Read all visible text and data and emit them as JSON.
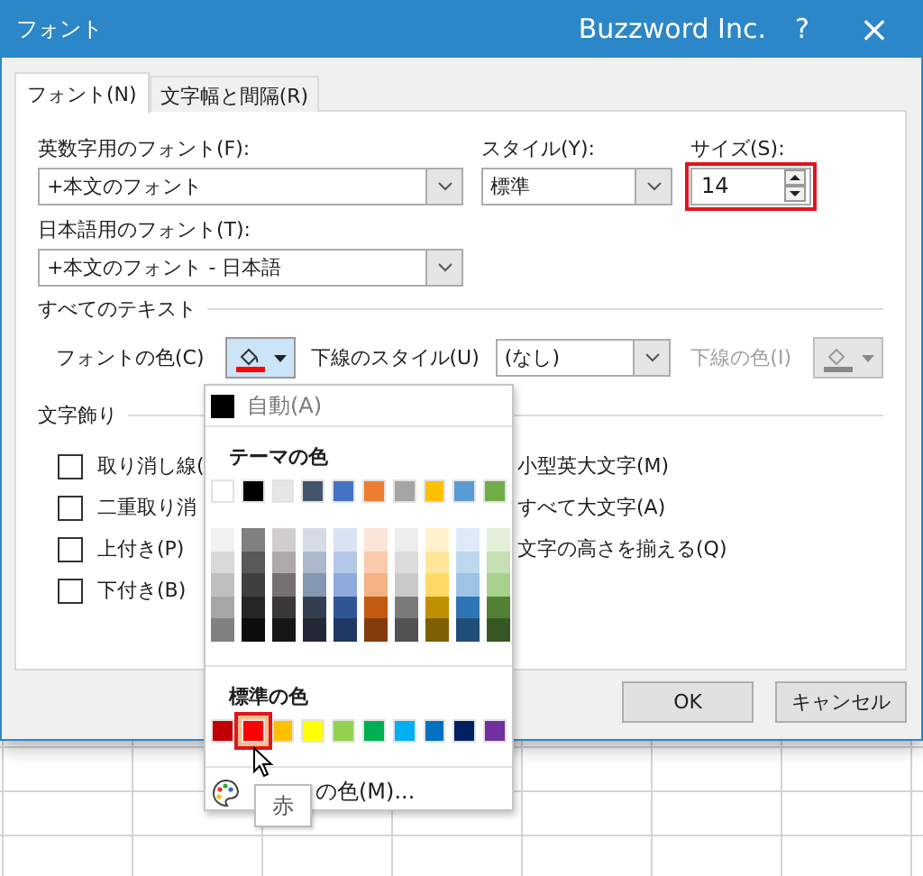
{
  "window": {
    "title": "フォント",
    "brand": "Buzzword Inc.",
    "help": "?",
    "close": "×"
  },
  "tabs": [
    {
      "label": "フォント(N)",
      "selected": true
    },
    {
      "label": "文字幅と間隔(R)",
      "selected": false
    }
  ],
  "fonts": {
    "latin_label": "英数字用のフォント(F):",
    "latin_value": "+本文のフォント",
    "style_label": "スタイル(Y):",
    "style_value": "標準",
    "size_label": "サイズ(S):",
    "size_value": "14",
    "size_highlighted": true,
    "japanese_label": "日本語用のフォント(T):",
    "japanese_value": "+本文のフォント - 日本語"
  },
  "all_text": {
    "heading": "すべてのテキスト",
    "font_color_label": "フォントの色(C)",
    "font_color_bar": {
      "color": "#ff0000"
    },
    "underline_style_label": "下線のスタイル(U)",
    "underline_style_value": "(なし)",
    "underline_color_label": "下線の色(I)",
    "underline_color_disabled": true
  },
  "effects": {
    "heading": "文字飾り",
    "left": [
      {
        "label": "取り消し線(",
        "checked": false
      },
      {
        "label": "二重取り消",
        "checked": false
      },
      {
        "label": "上付き(P)",
        "checked": false
      },
      {
        "label": "下付き(B)",
        "checked": false
      }
    ],
    "right": [
      "小型英大文字(M)",
      "すべて大文字(A)",
      "文字の高さを揃える(Q)"
    ]
  },
  "buttons": [
    "OK",
    "キャンセル"
  ],
  "color_menu": {
    "automatic": "自動(A)",
    "theme_heading": "テーマの色",
    "theme_colors": [
      {
        "color": "#ffffff",
        "shades": [
          {
            "color": "#f2f2f2"
          },
          {
            "color": "#d9d9d9"
          },
          {
            "color": "#bfbfbf"
          },
          {
            "color": "#a6a6a6"
          },
          {
            "color": "#808080"
          }
        ]
      },
      {
        "color": "#000000",
        "shades": [
          {
            "color": "#808080"
          },
          {
            "color": "#595959"
          },
          {
            "color": "#404040"
          },
          {
            "color": "#262626"
          },
          {
            "color": "#0d0d0d"
          }
        ]
      },
      {
        "color": "#e7e6e6",
        "shades": [
          {
            "color": "#d0cece"
          },
          {
            "color": "#aeaaaa"
          },
          {
            "color": "#767171"
          },
          {
            "color": "#3b3838"
          },
          {
            "color": "#171616"
          }
        ]
      },
      {
        "color": "#44546a",
        "shades": [
          {
            "color": "#d6dce5"
          },
          {
            "color": "#adb9ca"
          },
          {
            "color": "#8497b0"
          },
          {
            "color": "#333f50"
          },
          {
            "color": "#222a35"
          }
        ]
      },
      {
        "color": "#4472c4",
        "shades": [
          {
            "color": "#dae3f3"
          },
          {
            "color": "#b4c7e7"
          },
          {
            "color": "#8faadc"
          },
          {
            "color": "#2f5597"
          },
          {
            "color": "#203864"
          }
        ]
      },
      {
        "color": "#ed7d31",
        "shades": [
          {
            "color": "#fbe5d6"
          },
          {
            "color": "#f8cbad"
          },
          {
            "color": "#f4b183"
          },
          {
            "color": "#c55a11"
          },
          {
            "color": "#843c0c"
          }
        ]
      },
      {
        "color": "#a5a5a5",
        "shades": [
          {
            "color": "#ededed"
          },
          {
            "color": "#dbdbdb"
          },
          {
            "color": "#c9c9c9"
          },
          {
            "color": "#7b7b7b"
          },
          {
            "color": "#525252"
          }
        ]
      },
      {
        "color": "#ffc000",
        "shades": [
          {
            "color": "#fff2cc"
          },
          {
            "color": "#ffe699"
          },
          {
            "color": "#ffd966"
          },
          {
            "color": "#bf9000"
          },
          {
            "color": "#7f6000"
          }
        ]
      },
      {
        "color": "#5b9bd5",
        "shades": [
          {
            "color": "#deebf7"
          },
          {
            "color": "#bdd7ee"
          },
          {
            "color": "#9dc3e6"
          },
          {
            "color": "#2e75b6"
          },
          {
            "color": "#1f4e79"
          }
        ]
      },
      {
        "color": "#70ad47",
        "shades": [
          {
            "color": "#e2f0d9"
          },
          {
            "color": "#c5e0b4"
          },
          {
            "color": "#a9d18e"
          },
          {
            "color": "#548235"
          },
          {
            "color": "#385723"
          }
        ]
      }
    ],
    "standard_heading": "標準の色",
    "standard_colors": [
      {
        "color": "#c00000",
        "selected": false
      },
      {
        "color": "#ff0000",
        "selected": true
      },
      {
        "color": "#ffc000",
        "selected": false
      },
      {
        "color": "#ffff00",
        "selected": false
      },
      {
        "color": "#92d050",
        "selected": false
      },
      {
        "color": "#00b050",
        "selected": false
      },
      {
        "color": "#00b0f0",
        "selected": false
      },
      {
        "color": "#0070c0",
        "selected": false
      },
      {
        "color": "#002060",
        "selected": false
      },
      {
        "color": "#7030a0",
        "selected": false
      }
    ],
    "more_colors": "の色(M)..."
  },
  "tooltip": "赤"
}
